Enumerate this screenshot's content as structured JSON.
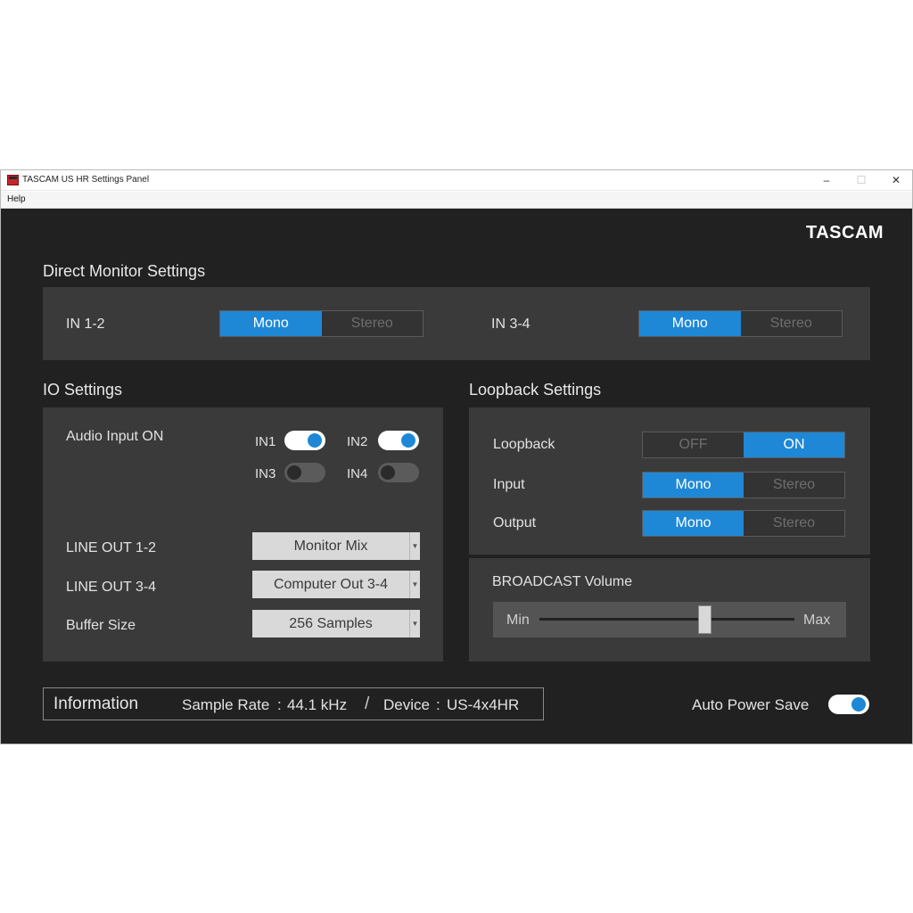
{
  "window": {
    "title": "TASCAM US HR Settings Panel",
    "menu": [
      "Help"
    ],
    "controls": {
      "minimize": "–",
      "maximize": "☐",
      "close": "✕"
    }
  },
  "logo": "TASCAM",
  "direct_monitor": {
    "title": "Direct Monitor Settings",
    "in12": {
      "label": "IN 1-2",
      "options": [
        "Mono",
        "Stereo"
      ],
      "selected": "Mono"
    },
    "in34": {
      "label": "IN 3-4",
      "options": [
        "Mono",
        "Stereo"
      ],
      "selected": "Mono"
    }
  },
  "io": {
    "title": "IO Settings",
    "audio_input_label": "Audio Input ON",
    "inputs": [
      {
        "label": "IN1",
        "on": true
      },
      {
        "label": "IN2",
        "on": true
      },
      {
        "label": "IN3",
        "on": false
      },
      {
        "label": "IN4",
        "on": false
      }
    ],
    "line_out_12": {
      "label": "LINE OUT 1-2",
      "value": "Monitor Mix"
    },
    "line_out_34": {
      "label": "LINE OUT 3-4",
      "value": "Computer Out 3-4"
    },
    "buffer_size": {
      "label": "Buffer Size",
      "value": "256 Samples"
    }
  },
  "loopback": {
    "title": "Loopback Settings",
    "loopback": {
      "label": "Loopback",
      "options": [
        "OFF",
        "ON"
      ],
      "selected": "ON"
    },
    "input": {
      "label": "Input",
      "options": [
        "Mono",
        "Stereo"
      ],
      "selected": "Mono"
    },
    "output": {
      "label": "Output",
      "options": [
        "Mono",
        "Stereo"
      ],
      "selected": "Mono"
    }
  },
  "broadcast": {
    "title": "BROADCAST Volume",
    "min_label": "Min",
    "max_label": "Max",
    "level": 0.65
  },
  "information": {
    "title": "Information",
    "sample_rate_label": "Sample Rate",
    "sample_rate_value": "44.1 kHz",
    "separator": "/",
    "device_label": "Device",
    "device_value": "US-4x4HR"
  },
  "auto_power_save": {
    "label": "Auto Power Save",
    "on": true
  },
  "colors": {
    "accent": "#1e88d6",
    "panel_bg": "#212121",
    "box_bg": "#3a3a3a"
  }
}
